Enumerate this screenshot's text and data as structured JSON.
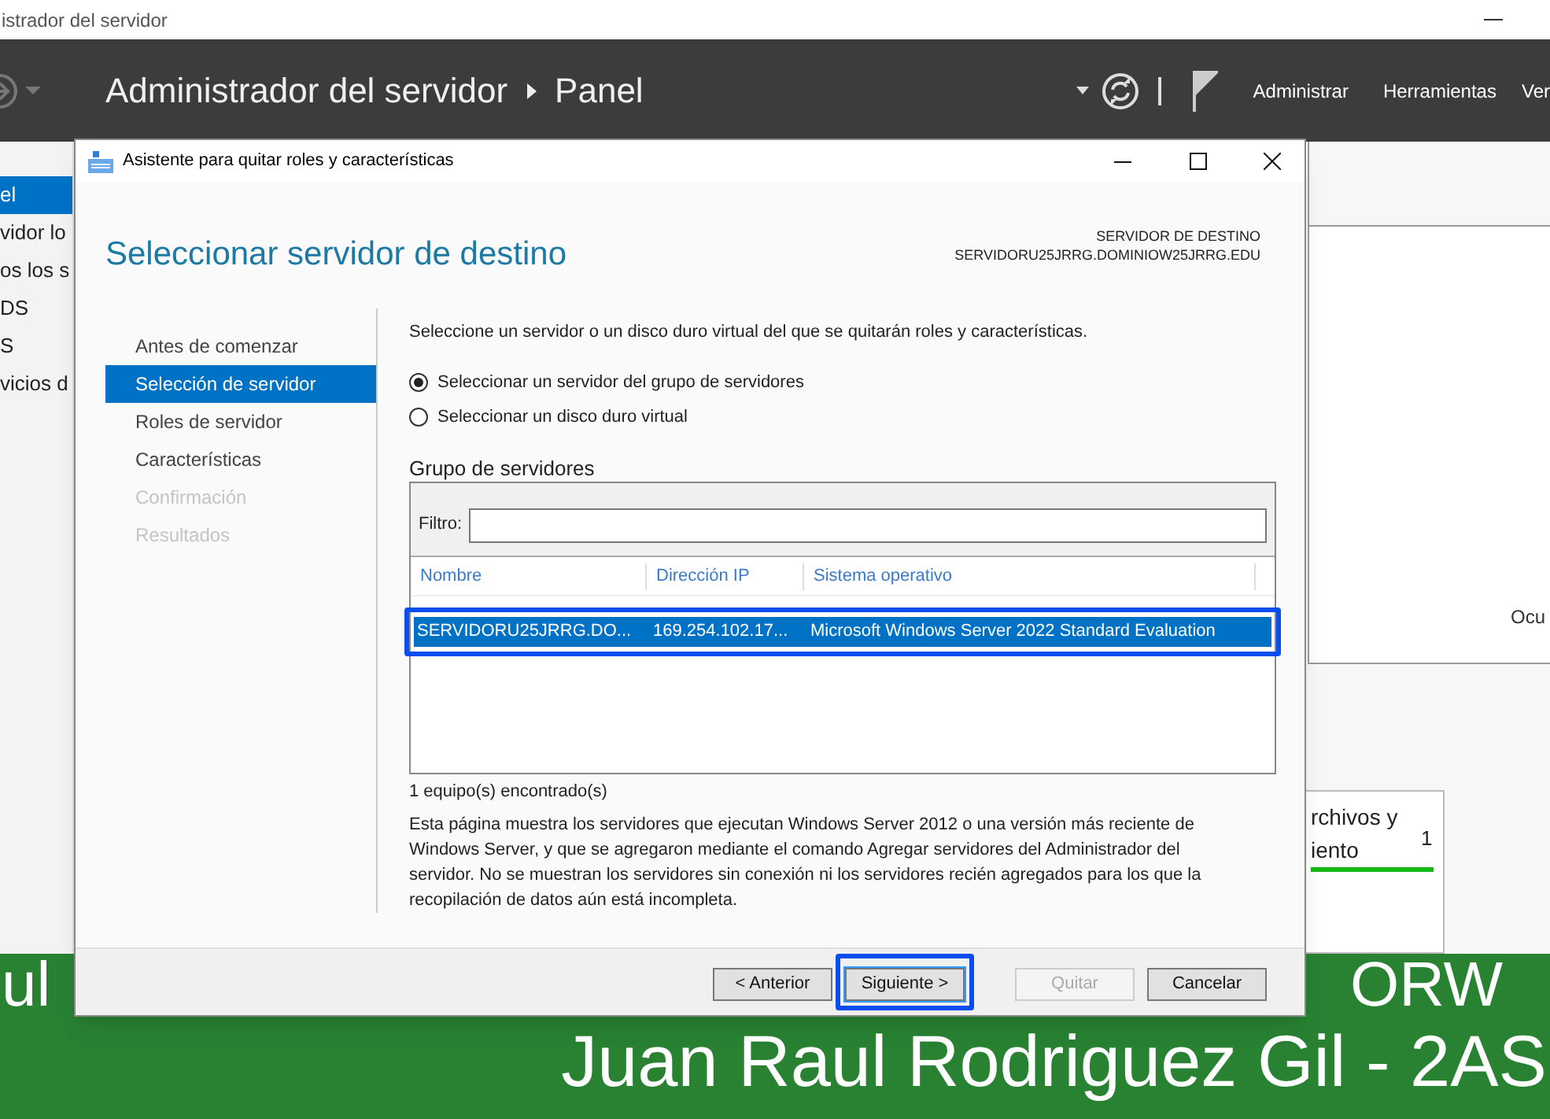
{
  "app_window": {
    "title": "istrador del servidor",
    "breadcrumb": "Administrador del servidor",
    "page": "Panel",
    "menu": [
      "Administrar",
      "Herramientas",
      "Ver"
    ]
  },
  "nav": [
    {
      "label": "el",
      "selected": true
    },
    {
      "label": "vidor lo",
      "selected": false
    },
    {
      "label": "os los s",
      "selected": false
    },
    {
      "label": "DS",
      "selected": false
    },
    {
      "label": "S",
      "selected": false
    },
    {
      "label": "vicios d",
      "selected": false
    }
  ],
  "dashboard": {
    "panel_text": "Ocu",
    "tile": {
      "line_1": "rchivos y",
      "line_2": "iento",
      "count": "1"
    }
  },
  "banner": {
    "line_1_left": "ul",
    "line_1_right": "ORW",
    "line_2": "Juan Raul Rodriguez Gil - 2AS"
  },
  "dialog": {
    "title": "Asistente para quitar roles y características",
    "heading": "Seleccionar servidor de destino",
    "destination_label": "SERVIDOR DE DESTINO",
    "destination_value": "SERVIDORU25JRRG.DOMINIOW25JRRG.EDU",
    "steps": [
      {
        "label": "Antes de comenzar",
        "selected": false,
        "disabled": false
      },
      {
        "label": "Selección de servidor",
        "selected": true,
        "disabled": false
      },
      {
        "label": "Roles de servidor",
        "selected": false,
        "disabled": false
      },
      {
        "label": "Características",
        "selected": false,
        "disabled": false
      },
      {
        "label": "Confirmación",
        "selected": false,
        "disabled": true
      },
      {
        "label": "Resultados",
        "selected": false,
        "disabled": true
      }
    ],
    "description": "Seleccione un servidor o un disco duro virtual del que se quitarán roles y características.",
    "options": [
      {
        "label": "Seleccionar un servidor del grupo de servidores",
        "selected": true
      },
      {
        "label": "Seleccionar un disco duro virtual",
        "selected": false
      }
    ],
    "group_title": "Grupo de servidores",
    "filter_label": "Filtro:",
    "columns": [
      "Nombre",
      "Dirección IP",
      "Sistema operativo"
    ],
    "rows": [
      {
        "cells": [
          "SERVIDORU25JRRG.DO...",
          "169.254.102.17...",
          "Microsoft Windows Server 2022 Standard Evaluation"
        ],
        "selected": true,
        "highlighted": true
      }
    ],
    "found": "1 equipo(s) encontrado(s)",
    "note": "Esta página muestra los servidores que ejecutan Windows Server 2012 o una versión más reciente de Windows Server, y que se agregaron mediante el comando Agregar servidores del Administrador del servidor. No se muestran los servidores sin conexión ni los servidores recién agregados para los que la recopilación de datos aún está incompleta.",
    "buttons": [
      {
        "label": "< Anterior",
        "disabled": false,
        "highlighted": false
      },
      {
        "label": "Siguiente >",
        "disabled": false,
        "highlighted": true
      },
      {
        "label": "Quitar",
        "disabled": true,
        "highlighted": false
      },
      {
        "label": "Cancelar",
        "disabled": false,
        "highlighted": false
      }
    ]
  }
}
